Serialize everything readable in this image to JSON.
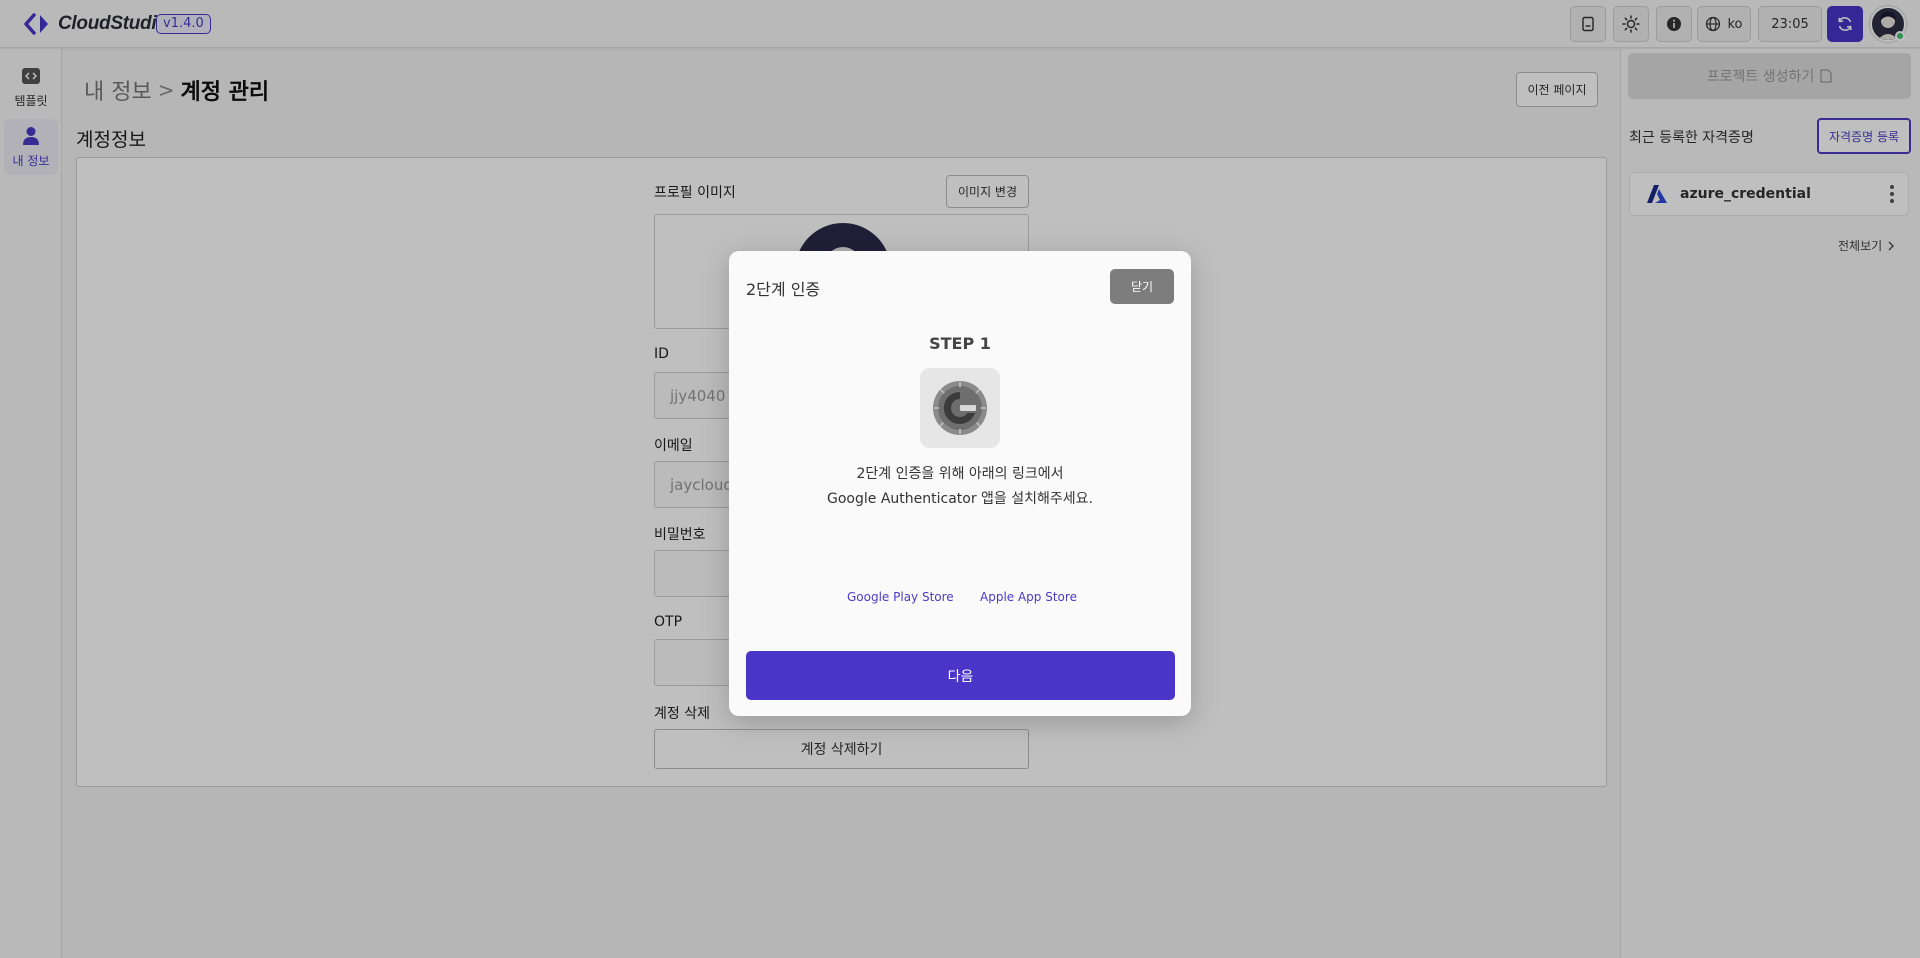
{
  "app": {
    "logo_text": "CloudStudio",
    "version": "v1.4.0",
    "language": "ko",
    "time": "23:05"
  },
  "sidebar": {
    "items": [
      {
        "label": "템플릿",
        "icon": "template-icon"
      },
      {
        "label": "내 정보",
        "icon": "user-icon",
        "active": true
      }
    ]
  },
  "main": {
    "breadcrumb_parent": "내 정보",
    "breadcrumb_sep": ">",
    "breadcrumb_current": "계정 관리",
    "prev_page_label": "이전 페이지",
    "section_title": "계정정보",
    "profile_image_label": "프로필 이미지",
    "change_image_label": "이미지 변경",
    "id_label": "ID",
    "id_value": "jjy4040",
    "email_label": "이메일",
    "email_value": "jaycloud",
    "password_label": "비밀번호",
    "otp_label": "OTP",
    "delete_label": "계정 삭제",
    "delete_button": "계정 삭제하기"
  },
  "right_panel": {
    "create_project_label": "프로젝트 생성하기",
    "recent_credentials_label": "최근 등록한 자격증명",
    "register_credential_label": "자격증명 등록",
    "credentials": [
      {
        "name": "azure_credential"
      }
    ],
    "view_all_label": "전체보기"
  },
  "modal": {
    "title": "2단계 인증",
    "close_label": "닫기",
    "step_label": "STEP 1",
    "description_line1": "2단계 인증을 위해 아래의 링크에서",
    "description_line2": "Google Authenticator 앱을 설치해주세요.",
    "google_play_label": "Google Play Store",
    "apple_store_label": "Apple App Store",
    "next_label": "다음"
  },
  "colors": {
    "accent": "#4a35c9",
    "overlay": "rgba(0,0,0,0.25)",
    "close_button": "#7d7d7d"
  }
}
